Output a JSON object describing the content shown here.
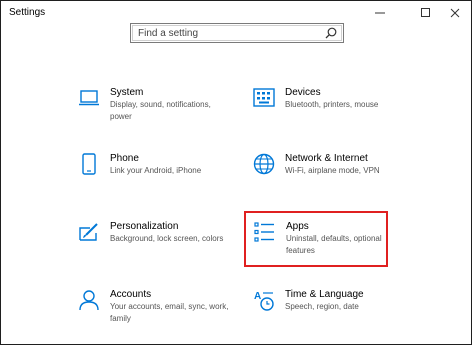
{
  "window": {
    "title": "Settings"
  },
  "search": {
    "placeholder": "Find a setting"
  },
  "tiles": [
    {
      "name": "System",
      "desc": "Display, sound, notifications, power",
      "icon": "laptop-icon"
    },
    {
      "name": "Devices",
      "desc": "Bluetooth, printers, mouse",
      "icon": "keyboard-icon"
    },
    {
      "name": "Phone",
      "desc": "Link your Android, iPhone",
      "icon": "phone-icon"
    },
    {
      "name": "Network & Internet",
      "desc": "Wi-Fi, airplane mode, VPN",
      "icon": "globe-icon"
    },
    {
      "name": "Personalization",
      "desc": "Background, lock screen, colors",
      "icon": "paintbrush-icon"
    },
    {
      "name": "Apps",
      "desc": "Uninstall, defaults, optional features",
      "icon": "apps-list-icon"
    },
    {
      "name": "Accounts",
      "desc": "Your accounts, email, sync, work, family",
      "icon": "person-icon"
    },
    {
      "name": "Time & Language",
      "desc": "Speech, region, date",
      "icon": "time-language-icon"
    }
  ],
  "colors": {
    "accent": "#0078d7",
    "highlight": "#e02020"
  }
}
